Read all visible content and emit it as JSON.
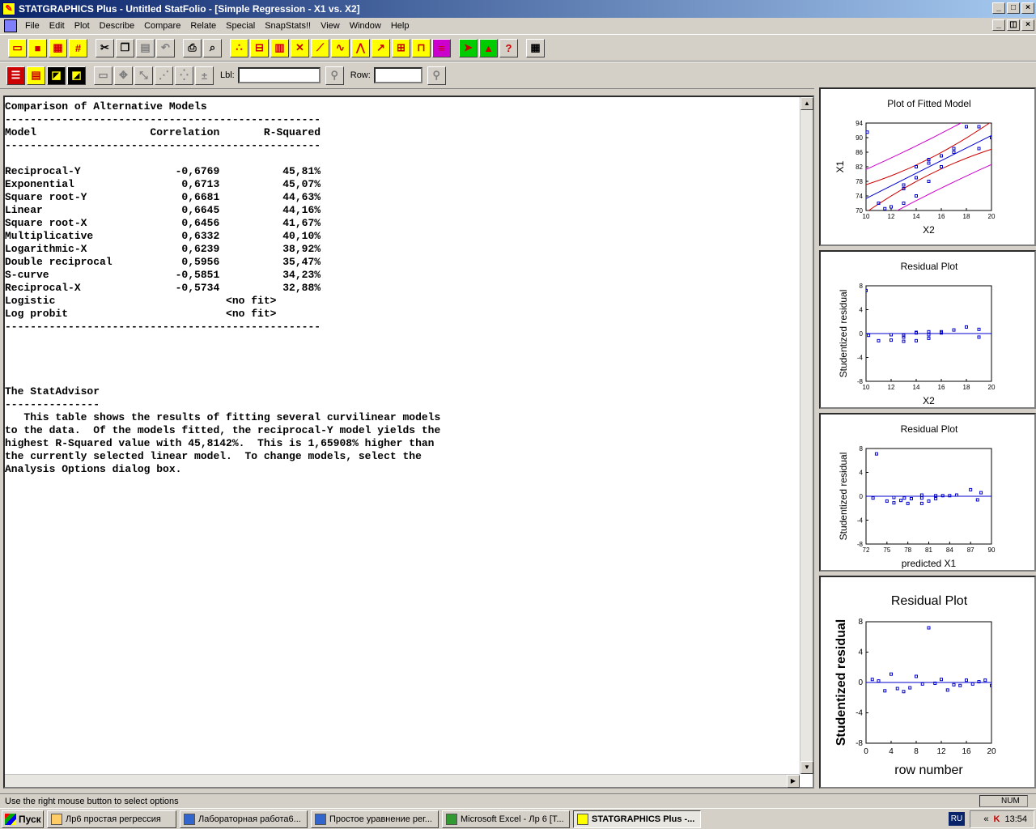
{
  "window": {
    "title": "STATGRAPHICS Plus - Untitled StatFolio - [Simple Regression - X1 vs. X2]"
  },
  "menu": [
    "File",
    "Edit",
    "Plot",
    "Describe",
    "Compare",
    "Relate",
    "Special",
    "SnapStats!!",
    "View",
    "Window",
    "Help"
  ],
  "toolbar2": {
    "lbl_label": "Lbl:",
    "row_label": "Row:"
  },
  "report": {
    "heading": "Comparison of Alternative Models",
    "rule": "--------------------------------------------------",
    "col_model": "Model",
    "col_correlation": "Correlation",
    "col_rsquared": "R-Squared",
    "rows": [
      {
        "model": "Reciprocal-Y",
        "corr": "-0,6769",
        "r2": "45,81%"
      },
      {
        "model": "Exponential",
        "corr": "0,6713",
        "r2": "45,07%"
      },
      {
        "model": "Square root-Y",
        "corr": "0,6681",
        "r2": "44,63%"
      },
      {
        "model": "Linear",
        "corr": "0,6645",
        "r2": "44,16%"
      },
      {
        "model": "Square root-X",
        "corr": "0,6456",
        "r2": "41,67%"
      },
      {
        "model": "Multiplicative",
        "corr": "0,6332",
        "r2": "40,10%"
      },
      {
        "model": "Logarithmic-X",
        "corr": "0,6239",
        "r2": "38,92%"
      },
      {
        "model": "Double reciprocal",
        "corr": "0,5956",
        "r2": "35,47%"
      },
      {
        "model": "S-curve",
        "corr": "-0,5851",
        "r2": "34,23%"
      },
      {
        "model": "Reciprocal-X",
        "corr": "-0,5734",
        "r2": "32,88%"
      },
      {
        "model": "Logistic",
        "corr": "",
        "r2": "<no fit>"
      },
      {
        "model": "Log probit",
        "corr": "",
        "r2": "<no fit>"
      }
    ],
    "advisor_title": "The StatAdvisor",
    "advisor_rule": "---------------",
    "advisor_lines": [
      "   This table shows the results of fitting several curvilinear models",
      "to the data.  Of the models fitted, the reciprocal-Y model yields the",
      "highest R-Squared value with 45,8142%.  This is 1,65908% higher than",
      "the currently selected linear model.  To change models, select the",
      "Analysis Options dialog box."
    ]
  },
  "panels": [
    {
      "title": "Plot of Fitted Model",
      "xlabel": "X2",
      "ylabel": "X1"
    },
    {
      "title": "Residual Plot",
      "xlabel": "X2",
      "ylabel": "Studentized residual"
    },
    {
      "title": "Residual Plot",
      "xlabel": "predicted X1",
      "ylabel": "Studentized residual"
    },
    {
      "title": "Residual Plot",
      "xlabel": "row number",
      "ylabel": "Studentized residual"
    }
  ],
  "chart_data": [
    {
      "type": "scatter",
      "title": "Plot of Fitted Model",
      "xlabel": "X2",
      "ylabel": "X1",
      "xlim": [
        10,
        20
      ],
      "ylim": [
        70,
        94
      ],
      "xticks": [
        "10",
        "12",
        "14",
        "16",
        "18",
        "20"
      ],
      "yticks": [
        "94",
        "90",
        "86",
        "82",
        "78",
        "74",
        "70"
      ],
      "x": [
        10.1,
        11,
        11.5,
        12,
        13,
        13,
        13,
        14,
        14,
        14,
        15,
        15,
        15,
        16,
        16,
        17,
        17,
        18,
        19,
        19,
        20
      ],
      "y": [
        91.5,
        72,
        70.5,
        71,
        72,
        76,
        77,
        74,
        79,
        82,
        78,
        83,
        84,
        82,
        85,
        86,
        87,
        93,
        87,
        93,
        90
      ],
      "fit_line": {
        "x": [
          10,
          20
        ],
        "y": [
          73.3,
          90.6
        ]
      },
      "colors": {
        "points": "#0000cc",
        "fit": "#0000cc",
        "confidence": "#cc0000",
        "prediction": "#cc00cc"
      }
    },
    {
      "type": "scatter",
      "title": "Residual Plot",
      "xlabel": "X2",
      "ylabel": "Studentized residual",
      "xlim": [
        10,
        20
      ],
      "ylim": [
        -8,
        8
      ],
      "xticks": [
        "10",
        "12",
        "14",
        "16",
        "18",
        "20"
      ],
      "yticks": [
        "8",
        "4",
        "0",
        "-4",
        "-8"
      ],
      "x": [
        10,
        10.2,
        11,
        12,
        12,
        13,
        13,
        13,
        14,
        14,
        14,
        15,
        15,
        15,
        16,
        16,
        17,
        18,
        19,
        19
      ],
      "y": [
        7.2,
        -0.3,
        -1.2,
        -0.2,
        -1.1,
        -0.6,
        -1.3,
        -0.3,
        -1.2,
        0.1,
        0.2,
        0.3,
        -0.8,
        -0.2,
        0.1,
        0.3,
        0.6,
        1.1,
        -0.6,
        0.7
      ]
    },
    {
      "type": "scatter",
      "title": "Residual Plot",
      "xlabel": "predicted X1",
      "ylabel": "Studentized residual",
      "xlim": [
        72,
        90
      ],
      "ylim": [
        -8,
        8
      ],
      "xticks": [
        "72",
        "75",
        "78",
        "81",
        "84",
        "87",
        "90"
      ],
      "yticks": [
        "8",
        "4",
        "0",
        "-4",
        "-8"
      ],
      "x": [
        73,
        73.5,
        75,
        76,
        76,
        77,
        77.5,
        78,
        78.5,
        80,
        80,
        80,
        81,
        82,
        82,
        83,
        84,
        85,
        87,
        88,
        88.5
      ],
      "y": [
        -0.3,
        7.1,
        -0.8,
        -0.2,
        -1.1,
        -0.7,
        -0.3,
        -1.2,
        -0.4,
        -1.2,
        -0.3,
        0.2,
        -0.8,
        0.1,
        -0.4,
        0.1,
        0.1,
        0.2,
        1.1,
        -0.6,
        0.6
      ]
    },
    {
      "type": "scatter",
      "title": "Residual Plot",
      "xlabel": "row number",
      "ylabel": "Studentized residual",
      "xlim": [
        0,
        20
      ],
      "ylim": [
        -8,
        8
      ],
      "xticks": [
        "0",
        "4",
        "8",
        "12",
        "16",
        "20"
      ],
      "yticks": [
        "8",
        "4",
        "0",
        "-4",
        "-8"
      ],
      "x": [
        1,
        2,
        3,
        4,
        5,
        6,
        7,
        8,
        9,
        10,
        11,
        12,
        13,
        14,
        15,
        16,
        17,
        18,
        19,
        20
      ],
      "y": [
        0.4,
        0.2,
        -1.1,
        1.1,
        -0.8,
        -1.2,
        -0.7,
        0.8,
        -0.2,
        7.2,
        -0.1,
        0.4,
        -1.0,
        -0.3,
        -0.4,
        0.3,
        -0.2,
        0.1,
        0.3,
        -0.4
      ]
    }
  ],
  "statusbar": {
    "text": "Use the right mouse button to select options",
    "num": "NUM"
  },
  "taskbar": {
    "start": "Пуск",
    "tasks": [
      "Лр6 простая регрессия",
      "Лабораторная работа6...",
      "Простое уравнение рег...",
      "Microsoft Excel - Лр 6  [Т...",
      "STATGRAPHICS Plus -..."
    ],
    "lang": "RU",
    "clock": "13:54"
  },
  "icons": [
    "statgraphics-app-icon",
    "open-folder-icon",
    "save-icon",
    "data-grid-icon",
    "calculator-grid-icon",
    "cut-icon",
    "copy-icon",
    "paste-icon",
    "undo-icon",
    "print-icon",
    "print-preview-icon",
    "calculator-icon",
    "help-icon"
  ]
}
